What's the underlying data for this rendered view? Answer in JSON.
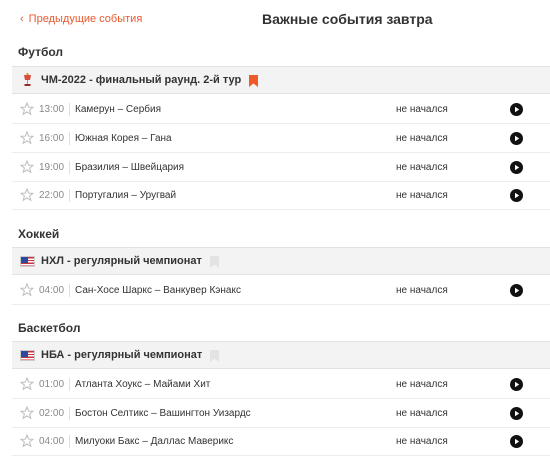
{
  "header": {
    "back_label": "Предыдущие события",
    "title": "Важные события завтра"
  },
  "sections": [
    {
      "sport": "Футбол",
      "league": {
        "name": "ЧМ-2022 - финальный раунд. 2-й тур",
        "icon": "trophy-icon",
        "bookmarked": true
      },
      "matches": [
        {
          "time": "13:00",
          "teams": "Камерун – Сербия",
          "status": "не начался"
        },
        {
          "time": "16:00",
          "teams": "Южная Корея – Гана",
          "status": "не начался"
        },
        {
          "time": "19:00",
          "teams": "Бразилия – Швейцария",
          "status": "не начался"
        },
        {
          "time": "22:00",
          "teams": "Португалия – Уругвай",
          "status": "не начался"
        }
      ]
    },
    {
      "sport": "Хоккей",
      "league": {
        "name": "НХЛ - регулярный чемпионат",
        "icon": "usa-flag-icon",
        "bookmarked": false
      },
      "matches": [
        {
          "time": "04:00",
          "teams": "Сан-Хосе Шаркс – Ванкувер Кэнакс",
          "status": "не начался"
        }
      ]
    },
    {
      "sport": "Баскетбол",
      "league": {
        "name": "НБА - регулярный чемпионат",
        "icon": "usa-flag-icon",
        "bookmarked": false
      },
      "matches": [
        {
          "time": "01:00",
          "teams": "Атланта Хоукс – Майами Хит",
          "status": "не начался"
        },
        {
          "time": "02:00",
          "teams": "Бостон Селтикс – Вашингтон Уизардс",
          "status": "не начался"
        },
        {
          "time": "04:00",
          "teams": "Милуоки Бакс – Даллас Маверикс",
          "status": "не начался"
        }
      ]
    }
  ],
  "colors": {
    "accent": "#e8582e",
    "league_bg": "#f3f3f3",
    "bookmark_active": "#f05a28",
    "bookmark_inactive": "#e3e3e3"
  }
}
